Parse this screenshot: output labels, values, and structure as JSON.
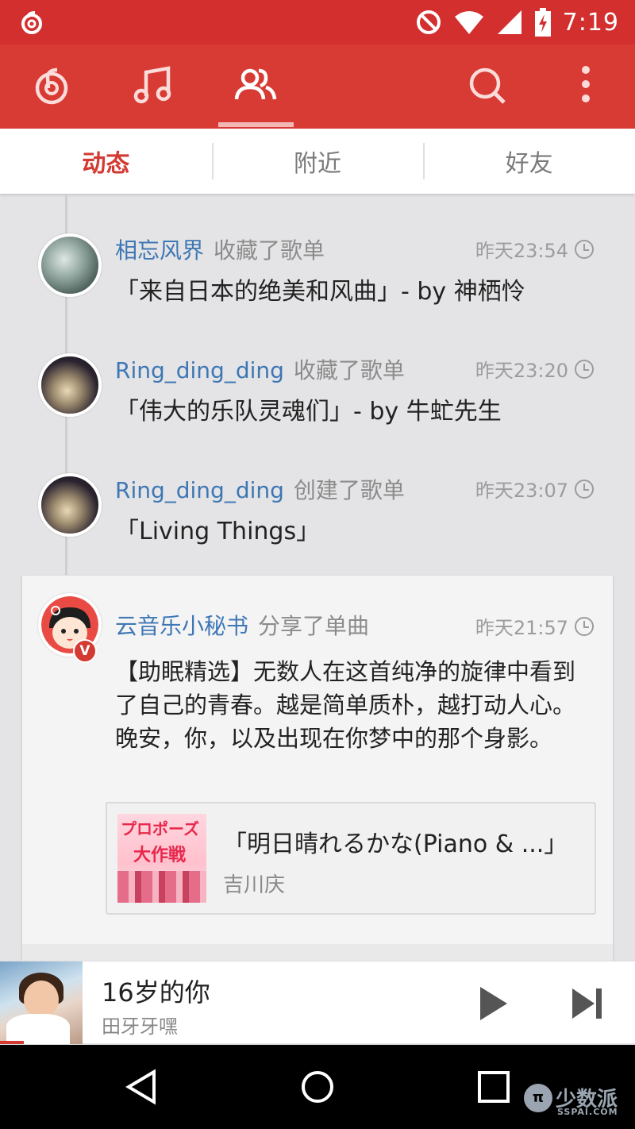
{
  "status_bar": {
    "time": "7:19"
  },
  "tabs": [
    {
      "label": "动态",
      "active": true
    },
    {
      "label": "附近",
      "active": false
    },
    {
      "label": "好友",
      "active": false
    }
  ],
  "feed": [
    {
      "user": "相忘风界",
      "action": "收藏了歌单",
      "time": "昨天23:54",
      "title": "「来自日本的绝美和风曲」- by 神栖怜"
    },
    {
      "user": "Ring_ding_ding",
      "action": "收藏了歌单",
      "time": "昨天23:20",
      "title": "「伟大的乐队灵魂们」- by 牛虻先生"
    },
    {
      "user": "Ring_ding_ding",
      "action": "创建了歌单",
      "time": "昨天23:07",
      "title": "「Living Things」"
    }
  ],
  "card": {
    "user": "云音乐小秘书",
    "badge": "V",
    "action": "分享了单曲",
    "time": "昨天21:57",
    "body": "【助眠精选】无数人在这首纯净的旋律中看到了自己的青春。越是简单质朴，越打动人心。晚安，你，以及出现在你梦中的那个身影。",
    "song": {
      "title": "「明日晴れるかな(Piano & ...」",
      "artist": "吉川庆",
      "cover_text_1": "プロポーズ",
      "cover_text_2": "大作戦"
    }
  },
  "player": {
    "title": "16岁的你",
    "artist": "田牙牙嘿"
  },
  "watermark": {
    "brand": "少数派",
    "domain": "SSPAI.COM",
    "logo": "π"
  },
  "colors": {
    "primary_red": "#d83a34",
    "link_blue": "#3e77b4"
  }
}
